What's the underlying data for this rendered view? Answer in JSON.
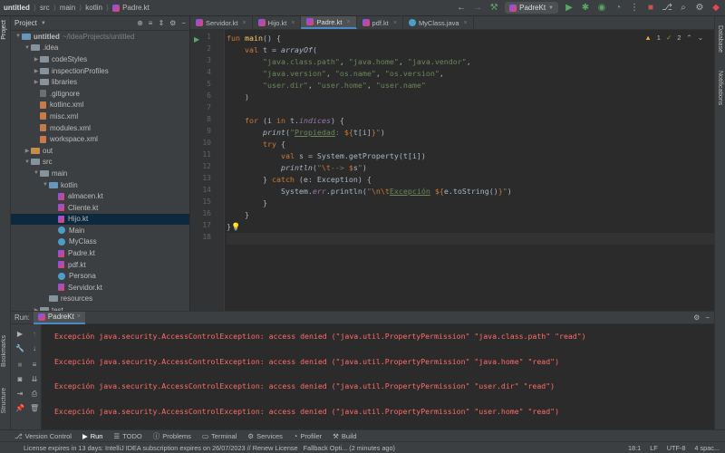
{
  "breadcrumb": [
    "untitled",
    "src",
    "main",
    "kotlin",
    "Padre.kt"
  ],
  "run_config": "PadreKt",
  "project_panel": {
    "title": "Project",
    "tree": [
      {
        "label": "untitled",
        "suffix": "~/IdeaProjects/untitled",
        "indent": 0,
        "kind": "folder-blue",
        "chev": "down"
      },
      {
        "label": ".idea",
        "indent": 1,
        "kind": "folder",
        "chev": "down"
      },
      {
        "label": "codeStyles",
        "indent": 2,
        "kind": "folder",
        "chev": "right"
      },
      {
        "label": "inspectionProfiles",
        "indent": 2,
        "kind": "folder",
        "chev": "right"
      },
      {
        "label": "libraries",
        "indent": 2,
        "kind": "folder",
        "chev": "right"
      },
      {
        "label": ".gitignore",
        "indent": 2,
        "kind": "git",
        "chev": ""
      },
      {
        "label": "kotlinc.xml",
        "indent": 2,
        "kind": "xml",
        "chev": ""
      },
      {
        "label": "misc.xml",
        "indent": 2,
        "kind": "xml",
        "chev": ""
      },
      {
        "label": "modules.xml",
        "indent": 2,
        "kind": "xml",
        "chev": ""
      },
      {
        "label": "workspace.xml",
        "indent": 2,
        "kind": "xml",
        "chev": ""
      },
      {
        "label": "out",
        "indent": 1,
        "kind": "folder-orange",
        "chev": "right"
      },
      {
        "label": "src",
        "indent": 1,
        "kind": "folder",
        "chev": "down"
      },
      {
        "label": "main",
        "indent": 2,
        "kind": "folder",
        "chev": "down"
      },
      {
        "label": "kotlin",
        "indent": 3,
        "kind": "folder-blue",
        "chev": "down"
      },
      {
        "label": "almacen.kt",
        "indent": 4,
        "kind": "kt",
        "chev": ""
      },
      {
        "label": "Cliente.kt",
        "indent": 4,
        "kind": "kt",
        "chev": ""
      },
      {
        "label": "Hijo.kt",
        "indent": 4,
        "kind": "kt",
        "chev": "",
        "selected": true
      },
      {
        "label": "Main",
        "indent": 4,
        "kind": "cls",
        "chev": ""
      },
      {
        "label": "MyClass",
        "indent": 4,
        "kind": "cls",
        "chev": ""
      },
      {
        "label": "Padre.kt",
        "indent": 4,
        "kind": "kt",
        "chev": ""
      },
      {
        "label": "pdf.kt",
        "indent": 4,
        "kind": "kt",
        "chev": ""
      },
      {
        "label": "Persona",
        "indent": 4,
        "kind": "cls",
        "chev": ""
      },
      {
        "label": "Servidor.kt",
        "indent": 4,
        "kind": "kt",
        "chev": ""
      },
      {
        "label": "resources",
        "indent": 3,
        "kind": "folder",
        "chev": ""
      },
      {
        "label": "test",
        "indent": 2,
        "kind": "folder",
        "chev": "right"
      }
    ]
  },
  "editor_tabs": [
    {
      "label": "Servidor.kt",
      "active": false
    },
    {
      "label": "Hijo.kt",
      "active": false
    },
    {
      "label": "Padre.kt",
      "active": true
    },
    {
      "label": "pdf.kt",
      "active": false
    },
    {
      "label": "MyClass.java",
      "active": false
    }
  ],
  "inspections": {
    "warnings": "1",
    "weak_warnings": "2"
  },
  "line_numbers": [
    "1",
    "2",
    "3",
    "4",
    "5",
    "6",
    "7",
    "8",
    "9",
    "10",
    "11",
    "12",
    "13",
    "14",
    "15",
    "16",
    "17",
    "18"
  ],
  "run_panel": {
    "label": "Run:",
    "tab": "PadreKt",
    "output": [
      "Excepción java.security.AccessControlException: access denied (\"java.util.PropertyPermission\" \"java.class.path\" \"read\")",
      "Excepción java.security.AccessControlException: access denied (\"java.util.PropertyPermission\" \"java.home\" \"read\")",
      "Excepción java.security.AccessControlException: access denied (\"java.util.PropertyPermission\" \"user.dir\" \"read\")",
      "Excepción java.security.AccessControlException: access denied (\"java.util.PropertyPermission\" \"user.home\" \"read\")"
    ]
  },
  "bottom_tools": [
    "Version Control",
    "Run",
    "TODO",
    "Problems",
    "Terminal",
    "Services",
    "Profiler",
    "Build"
  ],
  "status": {
    "message": "License expires in 13 days: IntelliJ IDEA subscription expires on 26/07/2023 // Renew License",
    "fallback": "Fallback Opti... (2 minutes ago)",
    "position": "18:1",
    "line_sep": "LF",
    "encoding": "UTF-8",
    "indent": "4 spac..."
  },
  "side_tabs": {
    "left_top": "Project",
    "left_bottom_1": "Bookmarks",
    "left_bottom_2": "Structure",
    "right_1": "Database",
    "right_2": "Notifications"
  },
  "colors": {
    "keyword": "#cc7832",
    "string": "#6a8759",
    "function": "#ffc66d",
    "error": "#ff6b68",
    "accent": "#4a88c7"
  }
}
